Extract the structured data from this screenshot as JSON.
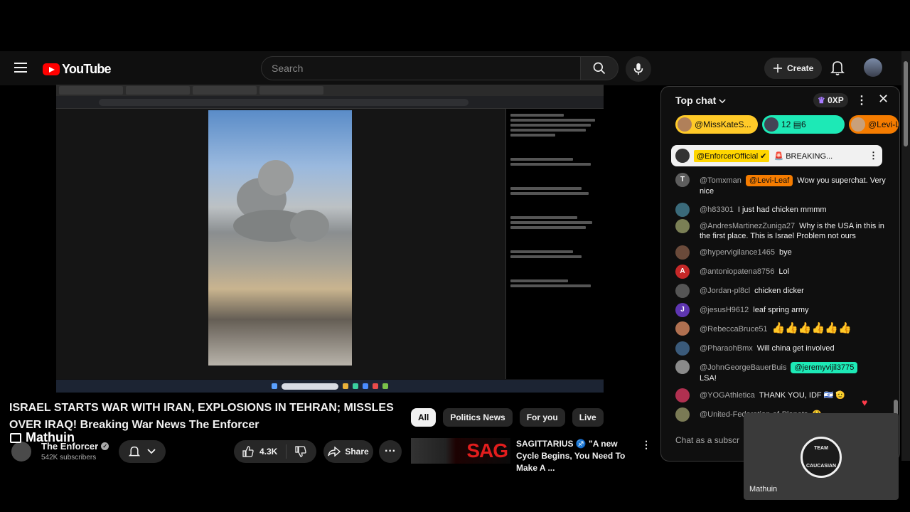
{
  "header": {
    "logo_text": "YouTube",
    "search_placeholder": "Search",
    "create_label": "Create"
  },
  "video": {
    "title": "ISRAEL STARTS WAR WITH IRAN, EXPLOSIONS IN TEHRAN; MISSLES OVER IRAQ! Breaking War News The Enforcer",
    "overlay_name": "Mathuin"
  },
  "channel": {
    "name": "The Enforcer",
    "subscribers": "542K subscribers"
  },
  "actions": {
    "likes": "4.3K",
    "share_label": "Share"
  },
  "chips": [
    "All",
    "Politics News",
    "For you",
    "Live"
  ],
  "recommended": {
    "thumb_text": "SAG",
    "title": "SAGITTARIUS ♐ \"A new Cycle Begins, You Need To Make A ..."
  },
  "chat": {
    "title": "Top chat",
    "xp": "0XP",
    "tickers": [
      {
        "label": "@MissKateS...",
        "color": "#ffca28"
      },
      {
        "label": "12  ▤6",
        "color": "#1de9b6"
      },
      {
        "label": "@Levi-L",
        "color": "#f57c00"
      }
    ],
    "pinned": {
      "author": "@EnforcerOfficial ✔",
      "text": "🚨 BREAKING..."
    },
    "messages": [
      {
        "avatar": "T",
        "avatar_color": "#5d5d5d",
        "author": "@Tomxman",
        "mention": "@Levi-Leaf",
        "mention_color": "#f57c00",
        "text": "Wow you superchat. Very nice"
      },
      {
        "avatar": "",
        "avatar_color": "#3a6a7a",
        "author": "@h83301",
        "mention": "",
        "text": "I just had chicken mmmm"
      },
      {
        "avatar": "",
        "avatar_color": "#7a7f55",
        "author": "@AndresMartinezZuniga27",
        "mention": "",
        "text": "Why is the USA in this in the first place. This is Israel Problem not ours"
      },
      {
        "avatar": "",
        "avatar_color": "#6a4a3a",
        "author": "@hypervigilance1465",
        "mention": "",
        "text": "bye"
      },
      {
        "avatar": "A",
        "avatar_color": "#c62828",
        "author": "@antoniopatena8756",
        "mention": "",
        "text": "Lol"
      },
      {
        "avatar": "",
        "avatar_color": "#555555",
        "author": "@Jordan-pl8cl",
        "mention": "",
        "text": "chicken dicker"
      },
      {
        "avatar": "J",
        "avatar_color": "#5e35b1",
        "author": "@jesusH9612",
        "mention": "",
        "text": "leaf spring army"
      },
      {
        "avatar": "",
        "avatar_color": "#b07050",
        "author": "@RebeccaBruce51",
        "mention": "",
        "text": "👍👍👍👍👍👍"
      },
      {
        "avatar": "",
        "avatar_color": "#3a5a7a",
        "author": "@PharaohBmx",
        "mention": "",
        "text": "Will china get involved"
      },
      {
        "avatar": "",
        "avatar_color": "#8a8a8a",
        "author": "@JohnGeorgeBauerBuis",
        "mention": "@jeremyvijil3775",
        "mention_color": "#1de9b6",
        "text": "LSA!"
      },
      {
        "avatar": "",
        "avatar_color": "#b03050",
        "author": "@YOGAthletica",
        "mention": "",
        "text": "THANK YOU, IDF 🇮🇱 🫡"
      },
      {
        "avatar": "",
        "avatar_color": "#7a7a55",
        "author": "@United-Federation-of-Planets",
        "mention": "",
        "text": "😫"
      }
    ],
    "input_placeholder": "Chat as a subscr"
  },
  "pip": {
    "badge_top": "TEAM",
    "badge_bottom": "CAUCASIAN",
    "name": "Mathuin"
  },
  "colors": {
    "background": "#0f0f0f",
    "brand_red": "#ff0000",
    "chip_bg": "#272727"
  }
}
